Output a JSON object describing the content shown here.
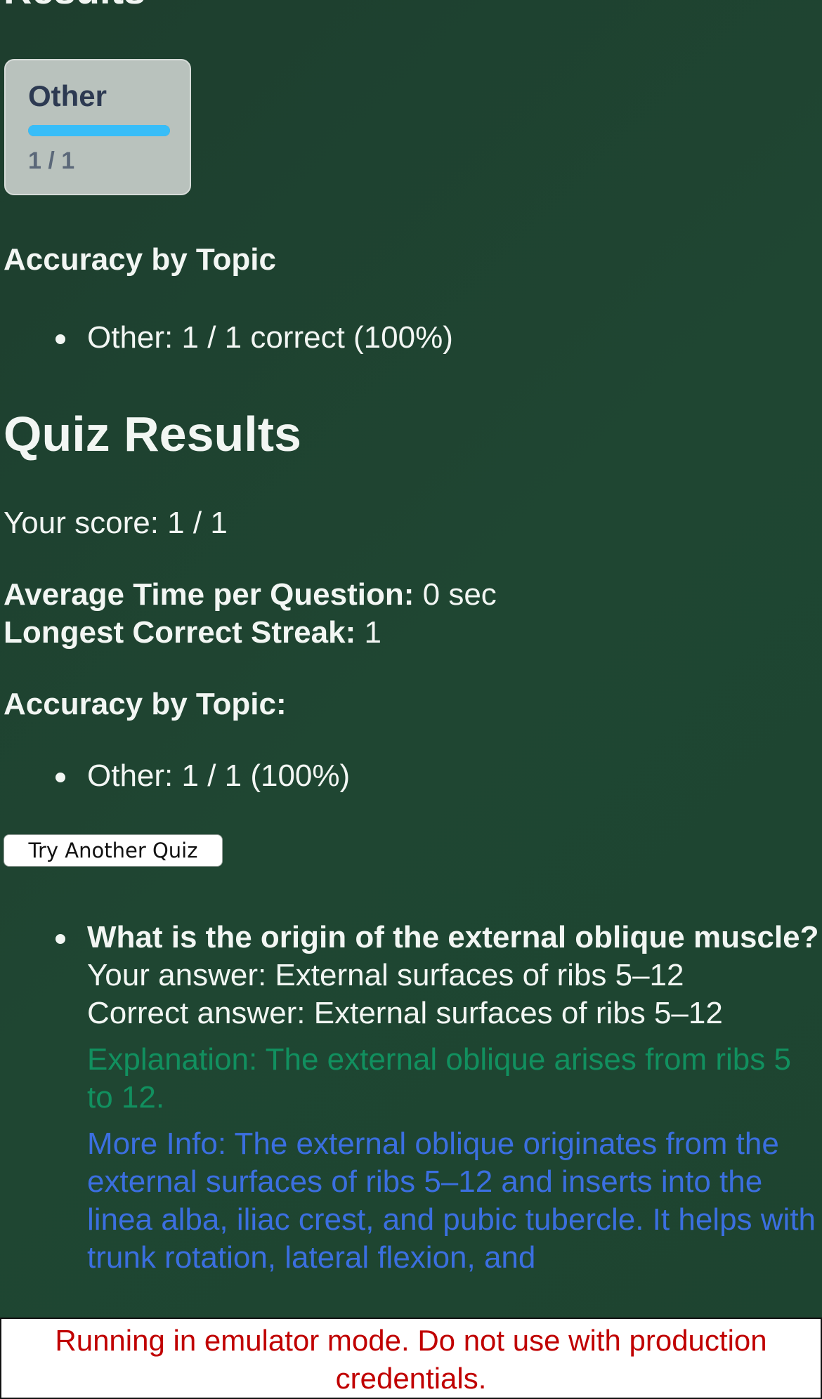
{
  "page_title_partial": "Results",
  "topic_card": {
    "name": "Other",
    "progress_fraction": 1.0,
    "count": "1 / 1",
    "bar_color": "#38bdf8"
  },
  "topic_accuracy": {
    "heading": "Accuracy by Topic",
    "items": [
      "Other: 1 / 1 correct (100%)"
    ]
  },
  "quiz_results": {
    "heading": "Quiz Results",
    "score_text": "Your score: 1 / 1",
    "avg_time_label": "Average Time per Question:",
    "avg_time_value": " 0 sec",
    "streak_label": "Longest Correct Streak:",
    "streak_value": " 1",
    "topic_heading": "Accuracy by Topic:",
    "topic_items": [
      "Other: 1 / 1 (100%)"
    ],
    "try_again_label": "Try Another Quiz"
  },
  "review": [
    {
      "question": "What is the origin of the external oblique muscle?",
      "your_answer": "Your answer: External surfaces of ribs 5–12",
      "correct_answer": "Correct answer: External surfaces of ribs 5–12",
      "explanation": "Explanation: The external oblique arises from ribs 5 to 12.",
      "more_info": "More Info: The external oblique originates from the external surfaces of ribs 5–12 and inserts into the linea alba, iliac crest, and pubic tubercle. It helps with trunk rotation, lateral flexion, and"
    }
  ],
  "emulator_banner": "Running in emulator mode. Do not use with production credentials.",
  "colors": {
    "background": "#1f4632",
    "explanation": "#11905f",
    "more_info": "#3b6fe0",
    "banner_text": "#c00000"
  }
}
